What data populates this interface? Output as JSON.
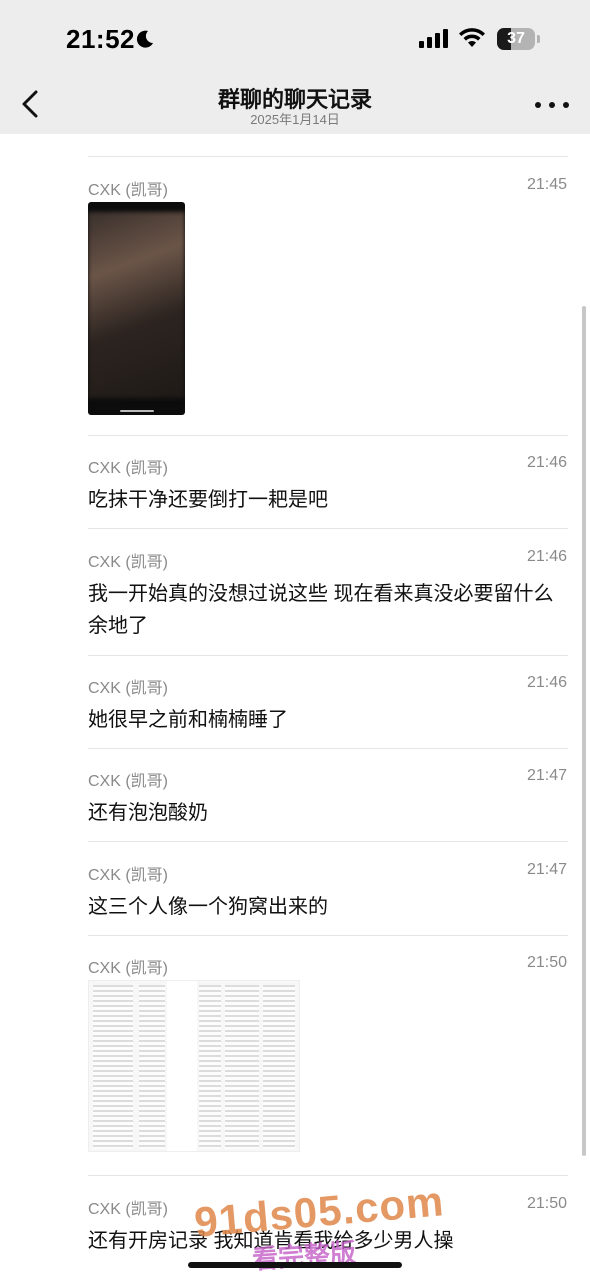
{
  "status_bar": {
    "time": "21:52",
    "battery_level": "37",
    "battery_fraction": 0.37,
    "icons": [
      "moon-icon",
      "signal-icon",
      "wifi-icon",
      "battery-icon"
    ]
  },
  "header": {
    "title": "群聊的聊天记录",
    "subtitle": "2025年1月14日",
    "back_icon": "chevron-left-icon",
    "more_icon": "more-dots-icon"
  },
  "messages": [
    {
      "sender": "CXK (凯哥)",
      "time": "21:45",
      "type": "video"
    },
    {
      "sender": "CXK (凯哥)",
      "time": "21:46",
      "text": "吃抹干净还要倒打一耙是吧"
    },
    {
      "sender": "CXK (凯哥)",
      "time": "21:46",
      "text": "我一开始真的没想过说这些 现在看来真没必要留什么余地了"
    },
    {
      "sender": "CXK (凯哥)",
      "time": "21:46",
      "text": "她很早之前和楠楠睡了"
    },
    {
      "sender": "CXK (凯哥)",
      "time": "21:47",
      "text": "还有泡泡酸奶"
    },
    {
      "sender": "CXK (凯哥)",
      "time": "21:47",
      "text": "这三个人像一个狗窝出来的"
    },
    {
      "sender": "CXK (凯哥)",
      "time": "21:50",
      "type": "image"
    },
    {
      "sender": "CXK (凯哥)",
      "time": "21:50",
      "text": "还有开房记录 我知道肯看我给多少男人操"
    }
  ],
  "watermark": {
    "text": "91ds05.com",
    "subtext": "看完整版"
  },
  "colors": {
    "header_bg": "#ededed",
    "meta_text": "#8a8a8a",
    "divider": "#e6e6e6",
    "watermark": "#e0874a"
  }
}
